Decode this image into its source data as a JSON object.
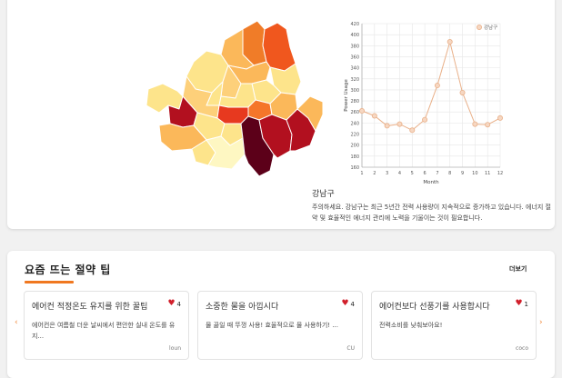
{
  "map": {
    "districts": [
      {
        "id": "dobong",
        "fill": "#f07c28"
      },
      {
        "id": "nowon",
        "fill": "#f0571e"
      },
      {
        "id": "gangbuk",
        "fill": "#fbb85a"
      },
      {
        "id": "eunpyeong",
        "fill": "#fde48b"
      },
      {
        "id": "seongbuk",
        "fill": "#fbb85a"
      },
      {
        "id": "jungnang",
        "fill": "#fde48b"
      },
      {
        "id": "jongno",
        "fill": "#fdd07a"
      },
      {
        "id": "dongdaemun",
        "fill": "#fde48b"
      },
      {
        "id": "seodaemun",
        "fill": "#fde48b"
      },
      {
        "id": "jung",
        "fill": "#fde48b"
      },
      {
        "id": "seongdong",
        "fill": "#f5762a"
      },
      {
        "id": "gwangjin",
        "fill": "#fbb85a"
      },
      {
        "id": "mapo",
        "fill": "#fdd07a"
      },
      {
        "id": "yongsan",
        "fill": "#e7391f"
      },
      {
        "id": "gangseo",
        "fill": "#fde48b"
      },
      {
        "id": "yangcheon",
        "fill": "#b2101f"
      },
      {
        "id": "yeongdeungpo",
        "fill": "#fde48b"
      },
      {
        "id": "guro",
        "fill": "#fbb85a"
      },
      {
        "id": "dongjak",
        "fill": "#fde48b"
      },
      {
        "id": "geumcheon",
        "fill": "#fde48b"
      },
      {
        "id": "gwanak",
        "fill": "#fef7c2"
      },
      {
        "id": "seocho",
        "fill": "#5c0019"
      },
      {
        "id": "gangnam",
        "fill": "#b2101f"
      },
      {
        "id": "songpa",
        "fill": "#b2101f"
      },
      {
        "id": "gangdong",
        "fill": "#fbb85a"
      }
    ]
  },
  "chart_data": {
    "type": "line",
    "x": [
      1,
      2,
      3,
      4,
      5,
      6,
      7,
      8,
      9,
      10,
      11,
      12
    ],
    "series": [
      {
        "name": "강남구",
        "values": [
          262,
          253,
          235,
          238,
          227,
          246,
          308,
          387,
          295,
          238,
          237,
          249
        ],
        "color": "#e9b089"
      }
    ],
    "xlabel": "Month",
    "ylabel": "Power Usage",
    "ylim": [
      160,
      420
    ],
    "yticks": [
      160,
      180,
      200,
      220,
      240,
      260,
      280,
      300,
      320,
      340,
      360,
      380,
      400,
      420
    ],
    "xticks": [
      1,
      2,
      3,
      4,
      5,
      6,
      7,
      8,
      9,
      10,
      11,
      12
    ],
    "grid": true,
    "legend": "top-right"
  },
  "district": {
    "name": "강남구",
    "description": "주의하세요. 강남구는 최근 5년간 전력 사용량이 지속적으로 증가하고 있습니다. 에너지 절약 및 효율적인 에너지 관리에 노력을 기울이는 것이 필요합니다."
  },
  "tips": {
    "title": "요즘 뜨는 절약 팁",
    "more": "더보기",
    "accent": "#f07820",
    "prev": "‹",
    "next": "›",
    "items": [
      {
        "title": "에어컨 적정온도 유지를 위한 꿀팁",
        "likes": "4",
        "body": "에어컨은 여름철 더운 날씨에서 편안한 실내 온도를 유지...",
        "author": "loun"
      },
      {
        "title": "소중한 물을 아낍시다",
        "likes": "4",
        "body": "물 끓일 때 뚜껑 사용! 효율적으로 물 사용하기! ...",
        "author": "CU"
      },
      {
        "title": "에어컨보다 선풍기를 사용합시다",
        "likes": "1",
        "body": "전력소비를 낮춰보아요!",
        "author": "coco"
      }
    ]
  }
}
